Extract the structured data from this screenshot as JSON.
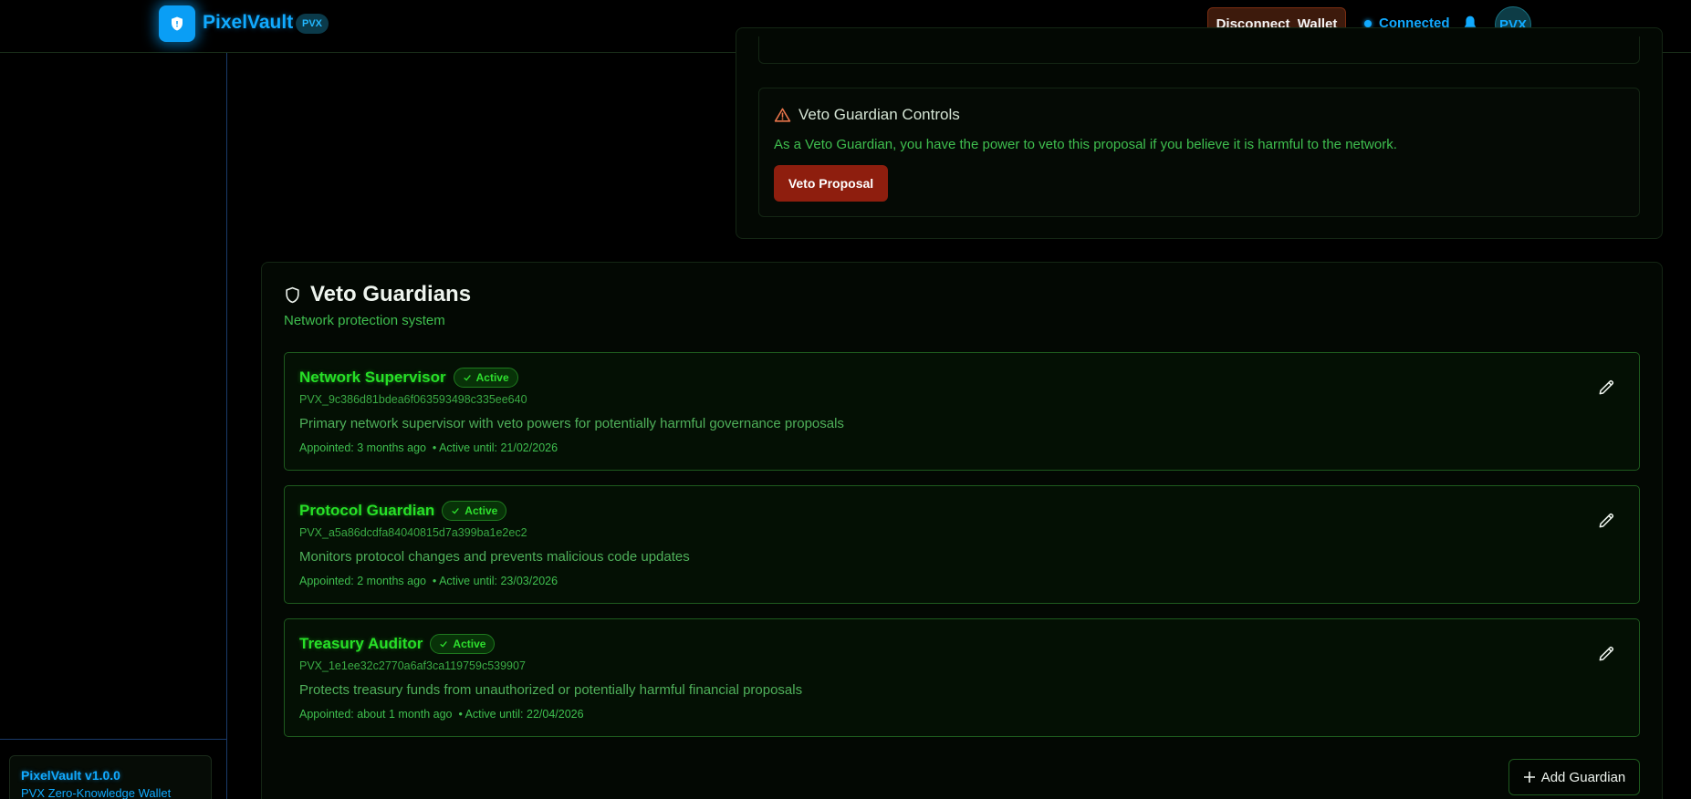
{
  "header": {
    "logo_text": "PixelVault",
    "logo_badge": "PVX",
    "disconnect_label": "Disconnect  Wallet",
    "status_label": "Connected",
    "avatar_text": "PVX"
  },
  "sidebar": {
    "version_title": "PixelVault v1.0.0",
    "version_sub": "PVX Zero-Knowledge Wallet"
  },
  "veto": {
    "title": "Veto Guardian Controls",
    "description": "As a Veto Guardian, you have the power to veto this proposal if you believe it is harmful to the network.",
    "button_label": "Veto Proposal"
  },
  "guardians": {
    "title": "Veto Guardians",
    "subtitle": "Network protection system",
    "add_label": "Add Guardian",
    "items": [
      {
        "name": "Network Supervisor",
        "status": "Active",
        "address": "PVX_9c386d81bdea6f063593498c335ee640",
        "description": "Primary network supervisor with veto powers for potentially harmful governance proposals",
        "meta": "Appointed: 3 months ago  • Active until: 21/02/2026"
      },
      {
        "name": "Protocol Guardian",
        "status": "Active",
        "address": "PVX_a5a86dcdfa84040815d7a399ba1e2ec2",
        "description": "Monitors protocol changes and prevents malicious code updates",
        "meta": "Appointed: 2 months ago  • Active until: 23/03/2026"
      },
      {
        "name": "Treasury Auditor",
        "status": "Active",
        "address": "PVX_1e1ee32c2770a6af3ca119759c539907",
        "description": "Protects treasury funds from unauthorized or potentially harmful financial proposals",
        "meta": "Appointed: about 1 month ago  • Active until: 22/04/2026"
      }
    ]
  },
  "colors": {
    "accent_blue": "#11aaff",
    "accent_green": "#27e027",
    "danger": "#8e1e0e"
  }
}
